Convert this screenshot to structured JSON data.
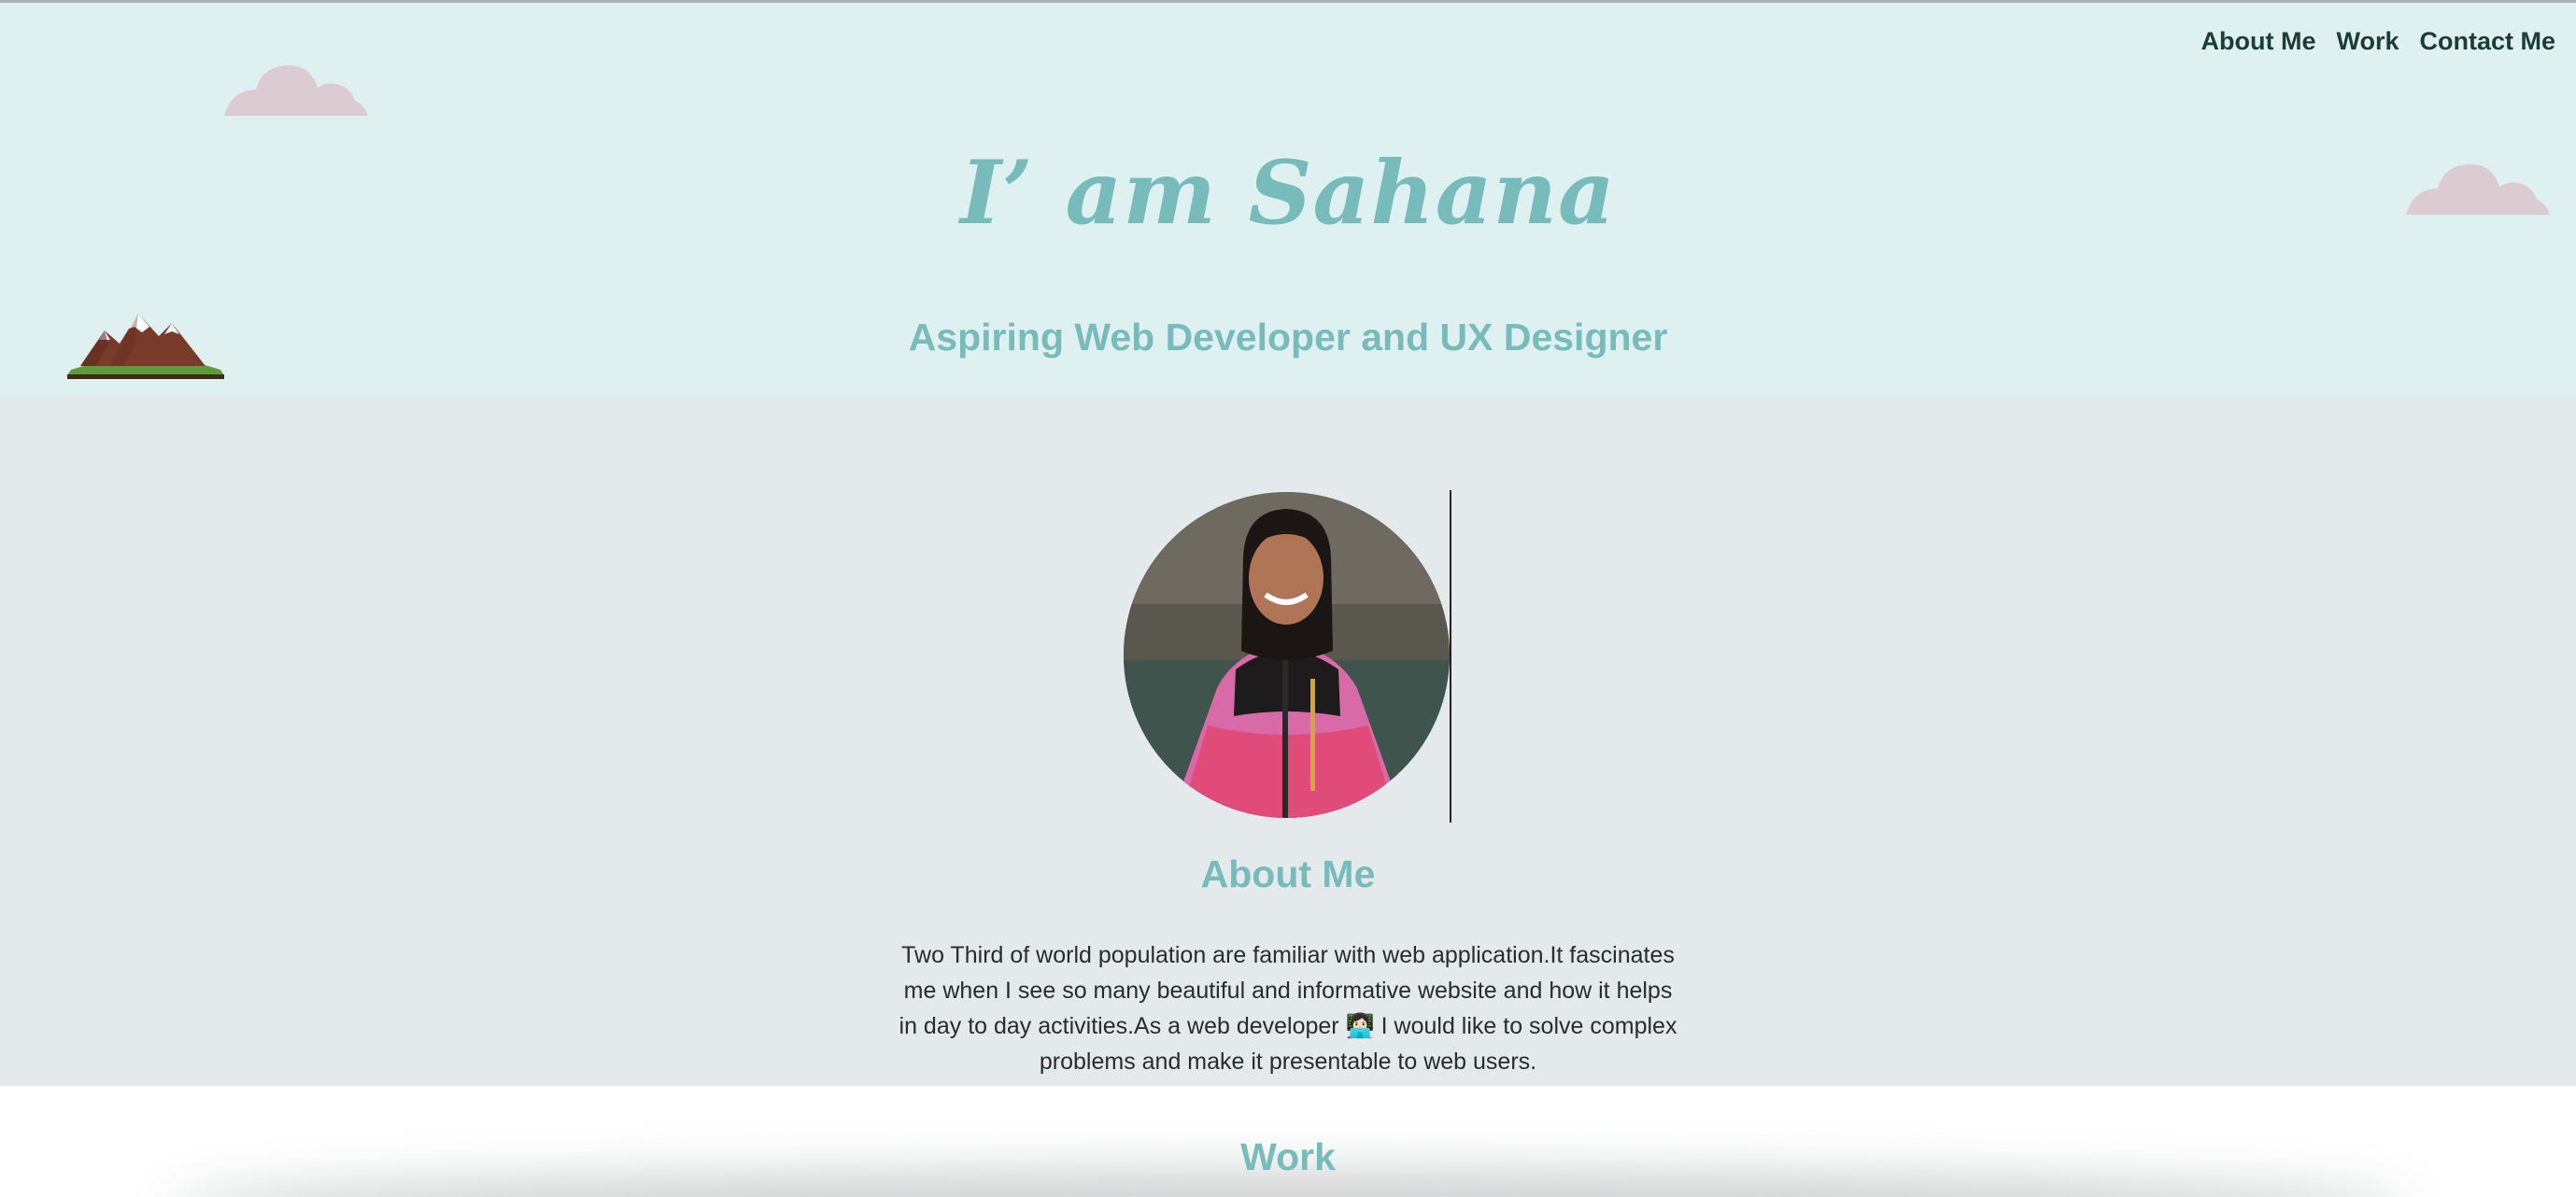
{
  "nav": {
    "about": "About Me",
    "work": "Work",
    "contact": "Contact Me"
  },
  "hero": {
    "title": "I’ am Sahana",
    "subtitle": "Aspiring Web Developer and UX Designer"
  },
  "about": {
    "heading": "About Me",
    "paragraph": "Two Third of world population are familiar with web application.It fascinates me when I see so many beautiful and informative website and how it helps in day to day activities.As a web developer 👩🏻‍💻 I would like to solve complex problems and make it presentable to web users."
  },
  "work": {
    "heading": "Work"
  },
  "colors": {
    "hero_bg": "#dff0f1",
    "section_bg": "#e4eaeb",
    "accent": "#78bbbb",
    "nav_text": "#1d3c34",
    "cloud": "#dcccd2"
  },
  "icons": {
    "cloud": "cloud-icon",
    "mountain": "mountain-icon"
  }
}
